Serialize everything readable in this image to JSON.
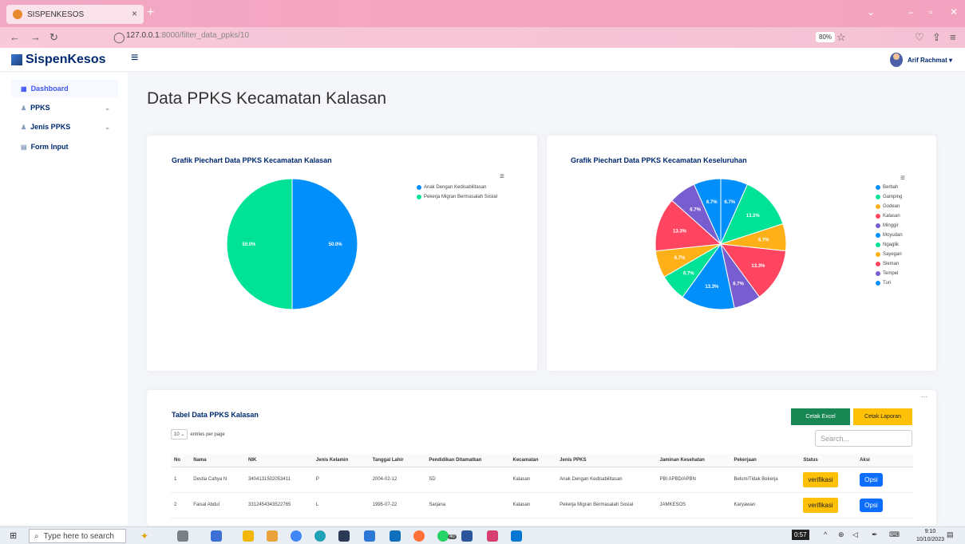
{
  "browser": {
    "tab_title": "SISPENKESOS",
    "tab_close": "×",
    "new_tab": "+",
    "url_host": "127.0.0.1",
    "url_path": ":8000/filter_data_ppks/10",
    "zoom": "80%"
  },
  "app": {
    "brand": "SispenKesos",
    "user": "Arif Rachmat ▾"
  },
  "sidebar": {
    "items": [
      {
        "label": "Dashboard"
      },
      {
        "label": "PPKS"
      },
      {
        "label": "Jenis PPKS"
      },
      {
        "label": "Form Input"
      }
    ]
  },
  "page": {
    "title": "Data PPKS Kecamatan Kalasan"
  },
  "chart_data": [
    {
      "type": "pie",
      "title": "Grafik Piechart Data PPKS Kecamatan Kalasan",
      "categories": [
        "Anak Dengan Kedisabilitasan",
        "Pekerja Migran Bermasalah Sosial"
      ],
      "values": [
        50.0,
        50.0
      ],
      "labels": [
        "50.0%",
        "50.0%"
      ],
      "colors": [
        "#008ffb",
        "#00e396"
      ],
      "legend": "top-right"
    },
    {
      "type": "pie",
      "title": "Grafik Piechart Data PPKS Kecamatan Keseluruhan",
      "categories": [
        "Berbah",
        "Gamping",
        "Godean",
        "Kalasan",
        "Minggir",
        "Moyudan",
        "Ngaglik",
        "Sayegan",
        "Sleman",
        "Tempel",
        "Turi"
      ],
      "values": [
        6.7,
        13.3,
        6.7,
        13.3,
        6.7,
        13.3,
        6.7,
        6.7,
        13.3,
        6.7,
        6.7
      ],
      "labels": [
        "6.7%",
        "13.3%",
        "6.7%",
        "13.3%",
        "6.7%",
        "13.3%",
        "6.7%",
        "6.7%",
        "13.3%",
        "6.7%",
        "6.7%"
      ],
      "colors": [
        "#008ffb",
        "#00e396",
        "#feb019",
        "#ff4560",
        "#775dd0",
        "#008ffb",
        "#00e396",
        "#feb019",
        "#ff4560",
        "#775dd0",
        "#008ffb"
      ],
      "legend": "right"
    }
  ],
  "table": {
    "title": "Tabel Data PPKS Kalasan",
    "export_excel": "Cetak Excel",
    "print_report": "Cetak Laporan",
    "search_placeholder": "Search...",
    "entries_value": "10",
    "entries_label": "entries per page",
    "columns": [
      "No",
      "Nama",
      "NIK",
      "Jenis Kelamin",
      "Tanggal Lahir",
      "Pendidikan Ditamatkan",
      "Kecamatan",
      "Jenis PPKS",
      "Jaminan Kesehatan",
      "Pekerjaan",
      "Status",
      "Aksi"
    ],
    "rows": [
      {
        "no": "1",
        "nama": "Destia Cahya N",
        "nik": "3404131502053411",
        "jk": "P",
        "tgl": "2004-02-12",
        "pendidikan": "SD",
        "kecamatan": "Kalasan",
        "jenis": "Anak Dengan Kedisabilitasan",
        "jaminan": "PBI APBD/APBN",
        "pekerjaan": "Belum/Tidak Bekerja",
        "status": "verifikasi",
        "aksi": "Opsi"
      },
      {
        "no": "2",
        "nama": "Faisal Abdul",
        "nik": "3312454343522765",
        "jk": "L",
        "tgl": "1995-07-22",
        "pendidikan": "Sarjana",
        "kecamatan": "Kalasan",
        "jenis": "Pekerja Migran Bermasalah Sosial",
        "jaminan": "JAMKESOS",
        "pekerjaan": "Karyawan",
        "status": "verifikasi",
        "aksi": "Opsi"
      }
    ]
  },
  "taskbar": {
    "search": "Type here to search",
    "badge": "0:57",
    "time": "9:10",
    "date": "10/10/2023",
    "whatsapp_count": "40"
  }
}
